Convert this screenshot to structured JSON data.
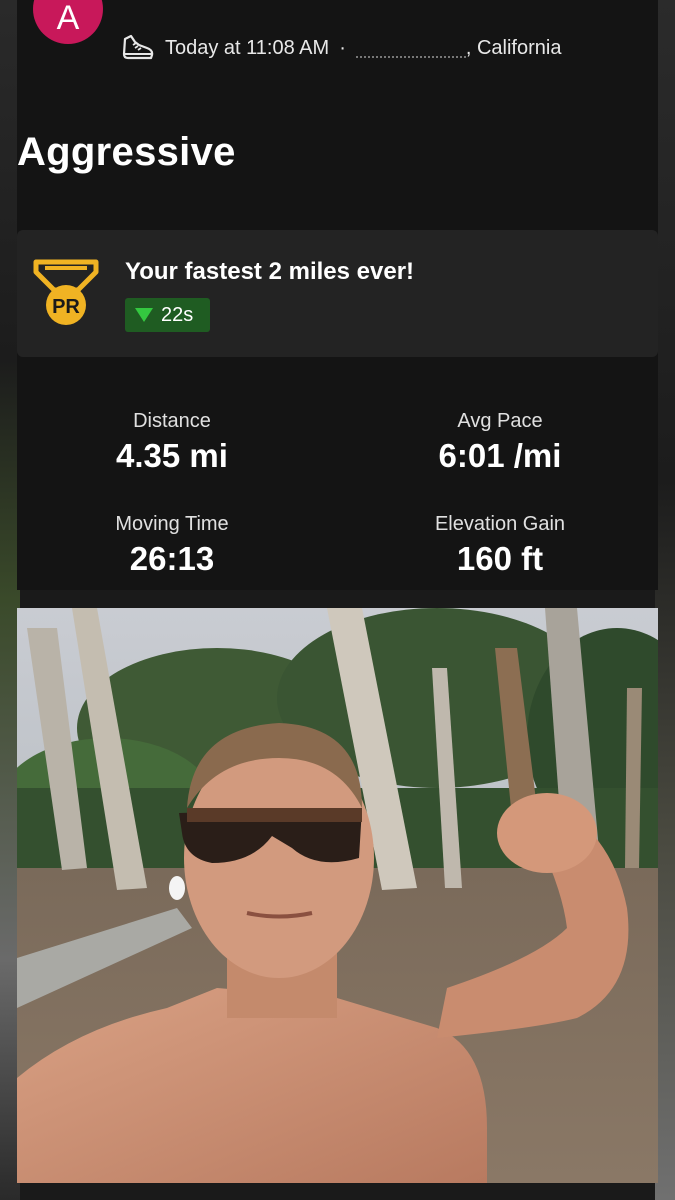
{
  "activity": {
    "avatar_initial": "A",
    "icon": "running-shoe-icon",
    "timestamp": "Today at 11:08 AM",
    "separator": "·",
    "location_suffix": ", California",
    "title": "Aggressive"
  },
  "achievement": {
    "badge_icon": "pr-medal-icon",
    "badge_text": "PR",
    "text": "Your fastest 2 miles ever!",
    "delta": "22s",
    "delta_icon": "down-triangle-icon"
  },
  "stats": [
    {
      "label": "Distance",
      "value": "4.35 mi"
    },
    {
      "label": "Avg Pace",
      "value": "6:01 /mi"
    },
    {
      "label": "Moving Time",
      "value": "26:13"
    },
    {
      "label": "Elevation Gain",
      "value": "160 ft"
    }
  ],
  "colors": {
    "avatar": "#c8185a",
    "pr_gold": "#f0b323",
    "delta_green": "#34c840",
    "delta_bg": "#1f5c22"
  }
}
